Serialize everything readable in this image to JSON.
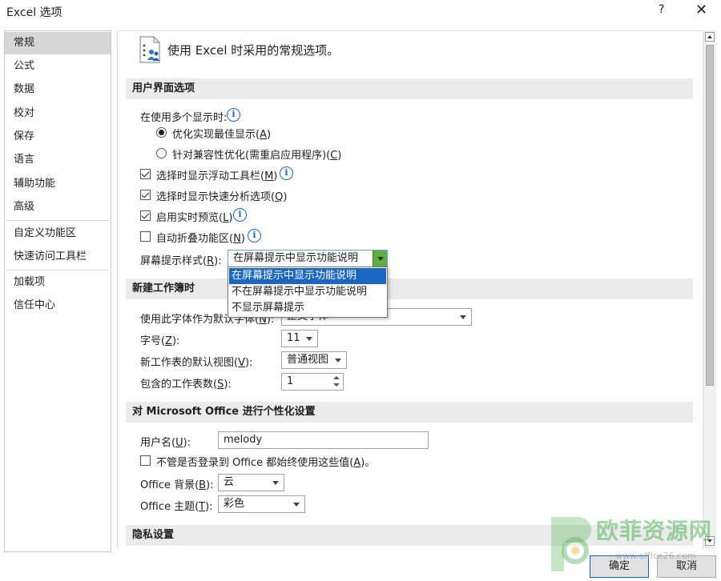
{
  "window": {
    "title": "Excel 选项",
    "help_label": "?",
    "close_label": "✕"
  },
  "sidebar": {
    "items": [
      {
        "label": "常规"
      },
      {
        "label": "公式"
      },
      {
        "label": "数据"
      },
      {
        "label": "校对"
      },
      {
        "label": "保存"
      },
      {
        "label": "语言"
      },
      {
        "label": "辅助功能"
      },
      {
        "label": "高级"
      },
      {
        "label": "自定义功能区"
      },
      {
        "label": "快速访问工具栏"
      },
      {
        "label": "加载项"
      },
      {
        "label": "信任中心"
      }
    ],
    "active_index": 0
  },
  "header": {
    "title": "使用 Excel 时采用的常规选项。",
    "icon": "settings-people-icon"
  },
  "ui_options": {
    "section_title": "用户界面选项",
    "multi_display_label": "在使用多个显示时:",
    "radio_optimize": {
      "text": "优化实现最佳显示(",
      "key": "A",
      "tail": ")",
      "checked": true
    },
    "radio_compat": {
      "text": "针对兼容性优化(需重启应用程序)(",
      "key": "C",
      "tail": ")",
      "checked": false
    },
    "mini_toolbar": {
      "text": "选择时显示浮动工具栏(",
      "key": "M",
      "tail": ")",
      "checked": true
    },
    "quick_analysis": {
      "text": "选择时显示快速分析选项(",
      "key": "Q",
      "tail": ")",
      "checked": true
    },
    "live_preview": {
      "text": "启用实时预览(",
      "key": "L",
      "tail": ")",
      "checked": true
    },
    "collapse_ribbon": {
      "text": "自动折叠功能区(",
      "key": "N",
      "tail": ")",
      "checked": false
    },
    "screentip_label": {
      "text": "屏幕提示样式(",
      "key": "R",
      "tail": "):"
    },
    "screentip_value": "在屏幕提示中显示功能说明",
    "screentip_options": [
      "在屏幕提示中显示功能说明",
      "不在屏幕提示中显示功能说明",
      "不显示屏幕提示"
    ]
  },
  "new_workbook": {
    "section_title": "新建工作簿时",
    "font_label": {
      "text": "使用此字体作为默认字体(",
      "key": "N",
      "tail": "):"
    },
    "font_value": "正文字体",
    "size_label": {
      "text": "字号(",
      "key": "Z",
      "tail": "):"
    },
    "size_value": "11",
    "view_label": {
      "text": "新工作表的默认视图(",
      "key": "V",
      "tail": "):"
    },
    "view_value": "普通视图",
    "sheets_label": {
      "text": "包含的工作表数(",
      "key": "S",
      "tail": "):"
    },
    "sheets_value": "1"
  },
  "personalize": {
    "section_title": "对 Microsoft Office 进行个性化设置",
    "username_label": {
      "text": "用户名(",
      "key": "U",
      "tail": "):"
    },
    "username_value": "melody",
    "always_use": {
      "text": "不管是否登录到 Office 都始终使用这些值(",
      "key": "A",
      "tail": ")。",
      "checked": false
    },
    "background_label": {
      "text": "Office 背景(",
      "key": "B",
      "tail": "):"
    },
    "background_value": "云",
    "theme_label": {
      "text": "Office 主题(",
      "key": "T",
      "tail": "):"
    },
    "theme_value": "彩色"
  },
  "privacy": {
    "section_title": "隐私设置"
  },
  "footer": {
    "ok_label": "确定",
    "cancel_label": "取消"
  },
  "watermark": {
    "text": "欧菲资源网",
    "url": "www.office26.com"
  },
  "colors": {
    "accent": "#1a66c4",
    "highlight_green": "#5fae3e",
    "section_bg": "#ebebeb"
  }
}
